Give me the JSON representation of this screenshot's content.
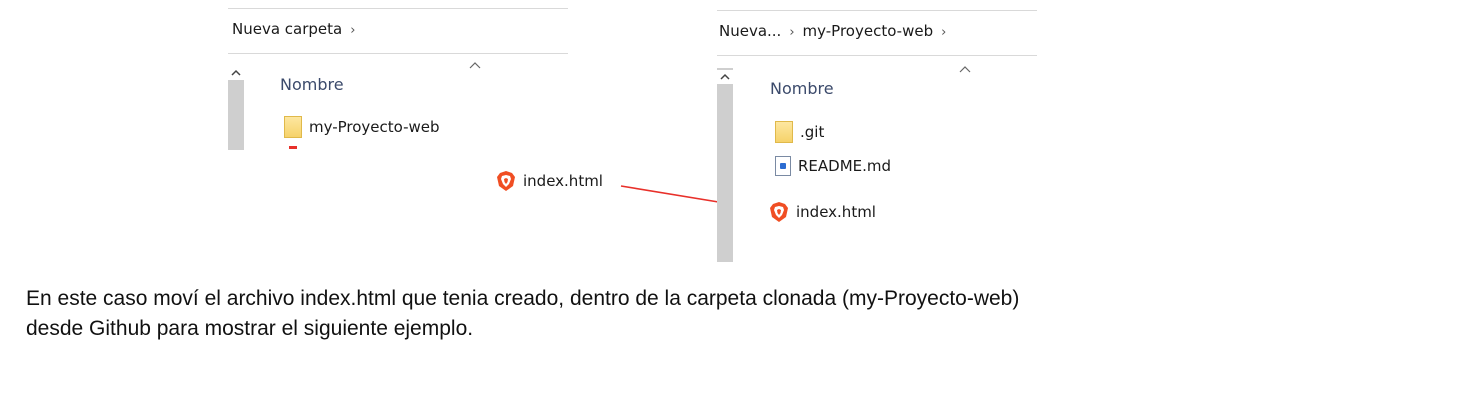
{
  "left_window": {
    "breadcrumb": [
      "Nueva carpeta"
    ],
    "column_header": "Nombre",
    "items": [
      {
        "name": "my-Proyecto-web",
        "icon": "folder-icon"
      }
    ]
  },
  "floating_file": {
    "name": "index.html",
    "icon": "brave-icon"
  },
  "right_window": {
    "breadcrumb": [
      "Nueva...",
      "my-Proyecto-web"
    ],
    "column_header": "Nombre",
    "items": [
      {
        "name": ".git",
        "icon": "folder-icon"
      },
      {
        "name": "README.md",
        "icon": "document-icon"
      },
      {
        "name": "index.html",
        "icon": "brave-icon"
      }
    ]
  },
  "arrow": {
    "color": "#e8302a"
  },
  "caption": {
    "line1": "En este caso moví el archivo index.html  que tenia creado, dentro de la carpeta  clonada (my-Proyecto-web)",
    "line2": "desde Github para mostrar el siguiente ejemplo."
  }
}
